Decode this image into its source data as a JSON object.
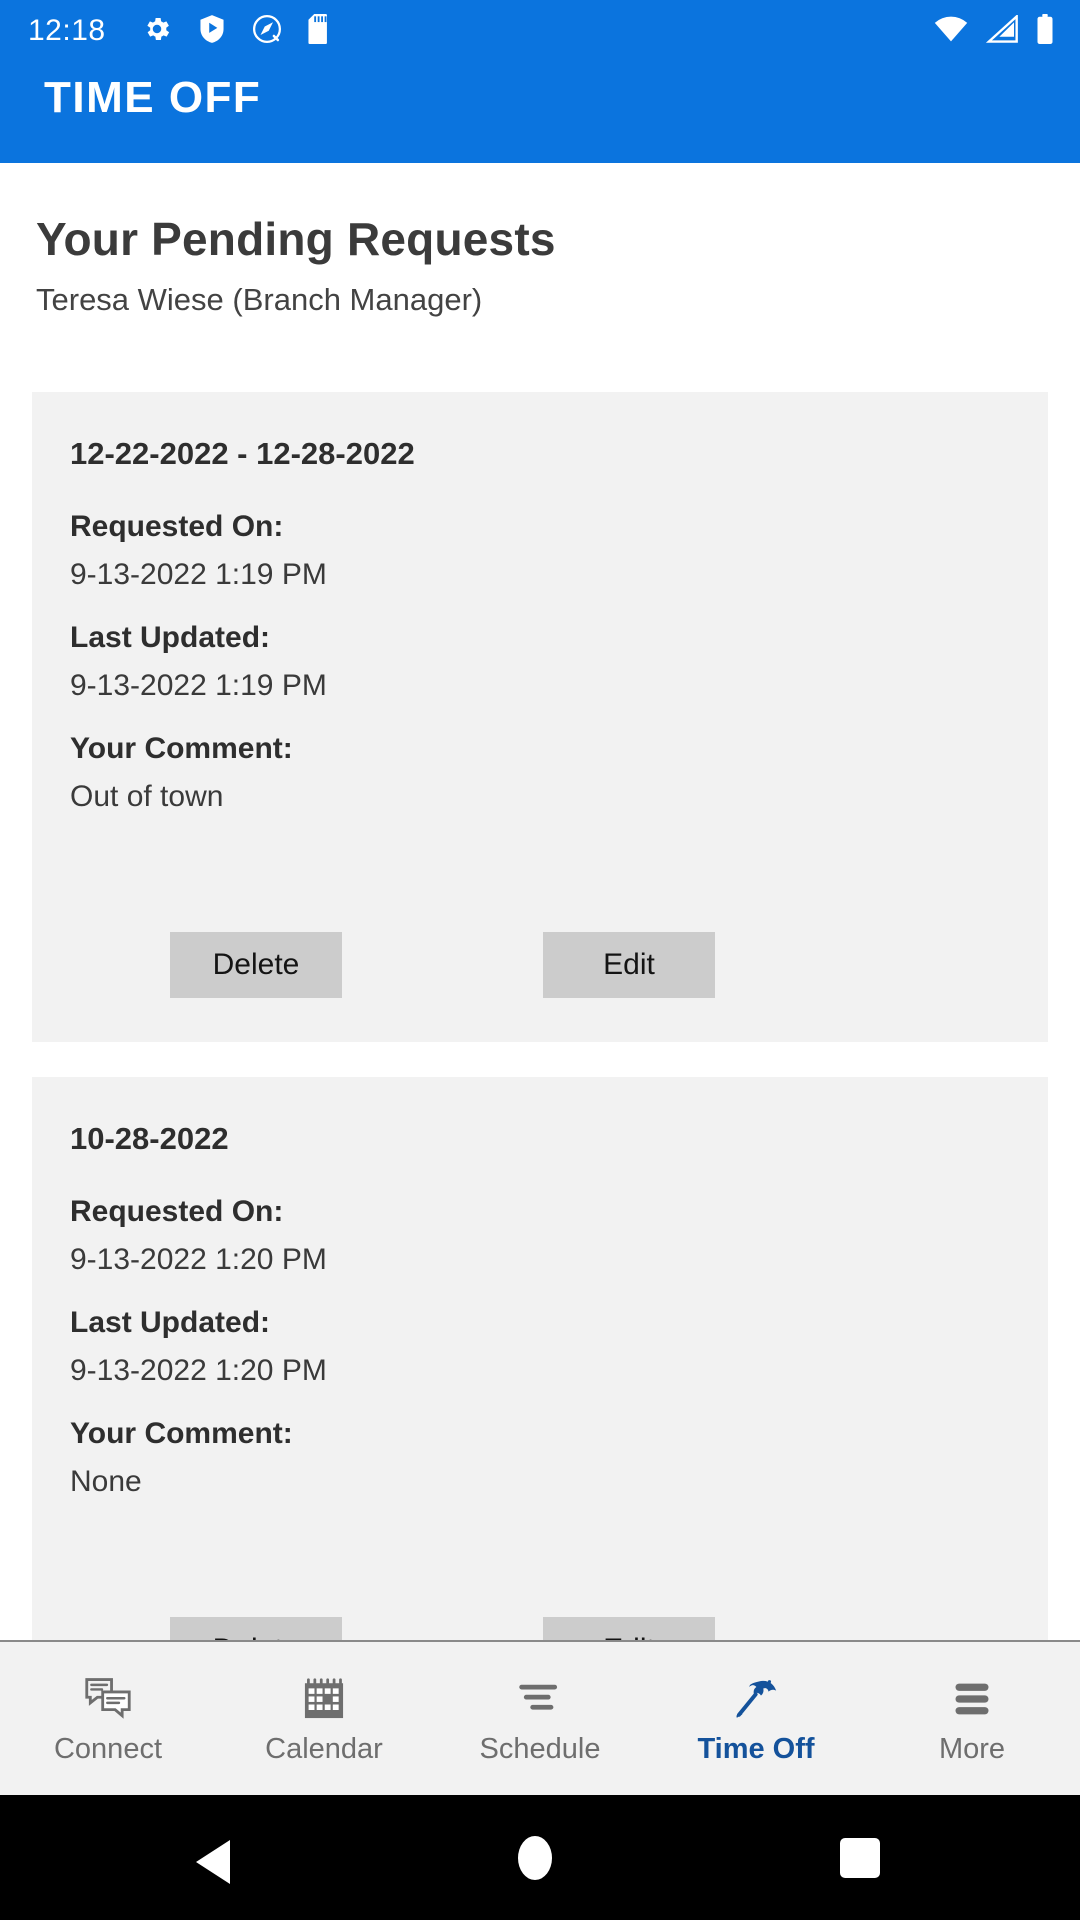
{
  "statusbar": {
    "time": "12:18",
    "left_icons": [
      "gear-icon",
      "play-shield-icon",
      "quick-settings-icon",
      "sd-card-icon"
    ],
    "right_icons": [
      "wifi-icon",
      "cell-signal-icon",
      "battery-icon"
    ],
    "background_color": "#0B74DE"
  },
  "appbar": {
    "title": "TIME OFF"
  },
  "header": {
    "title": "Your Pending Requests",
    "subtitle": "Teresa Wiese (Branch Manager)"
  },
  "labels": {
    "requested_on": "Requested On:",
    "last_updated": "Last Updated:",
    "your_comment": "Your Comment:",
    "delete": "Delete",
    "edit": "Edit"
  },
  "requests": [
    {
      "date_range": "12-22-2022 - 12-28-2022",
      "requested_on": "9-13-2022 1:19 PM",
      "last_updated": "9-13-2022 1:19 PM",
      "comment": "Out of town"
    },
    {
      "date_range": "10-28-2022",
      "requested_on": "9-13-2022 1:20 PM",
      "last_updated": "9-13-2022 1:20 PM",
      "comment": "None"
    }
  ],
  "bottom_nav": {
    "active_color": "#14529B",
    "inactive_color": "#6E6E6E",
    "items": [
      {
        "label": "Connect",
        "icon": "chat-bubbles-icon",
        "active": false
      },
      {
        "label": "Calendar",
        "icon": "calendar-icon",
        "active": false
      },
      {
        "label": "Schedule",
        "icon": "schedule-lines-icon",
        "active": false
      },
      {
        "label": "Time Off",
        "icon": "beach-umbrella-icon",
        "active": true
      },
      {
        "label": "More",
        "icon": "hamburger-menu-icon",
        "active": false
      }
    ]
  },
  "system_nav": {
    "back": "back-button",
    "home": "home-button",
    "recents": "recents-button"
  }
}
